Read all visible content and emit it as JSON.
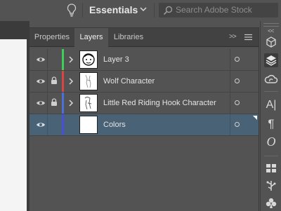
{
  "app_bar": {
    "workspace": "Essentials",
    "search_placeholder": "Search Adobe Stock"
  },
  "panel": {
    "tabs": [
      {
        "label": "Properties",
        "active": false
      },
      {
        "label": "Layers",
        "active": true
      },
      {
        "label": "Libraries",
        "active": false
      }
    ],
    "collapse_label": ">>",
    "layers": [
      {
        "name": "Layer 3",
        "color": "#3ecf5b",
        "locked": false,
        "visible": true,
        "expandable": true,
        "selected": false
      },
      {
        "name": "Wolf Character",
        "color": "#d94545",
        "locked": true,
        "visible": true,
        "expandable": true,
        "selected": false
      },
      {
        "name": "Little Red Riding Hook Character",
        "color": "#4a72d6",
        "locked": true,
        "visible": true,
        "expandable": true,
        "selected": false
      },
      {
        "name": "Colors",
        "color": "#4a4ed8",
        "locked": false,
        "visible": true,
        "expandable": false,
        "selected": true
      }
    ]
  },
  "tool_strip": {
    "icons": [
      "cube-icon",
      "layers-icon",
      "creative-cloud-icon",
      "character-icon",
      "paragraph-icon",
      "opentype-icon",
      "swatches-icon",
      "symbols-icon",
      "club-icon"
    ],
    "glyphs": {
      "character": "A|",
      "paragraph": "¶",
      "opentype": "O"
    },
    "selected": "layers-icon"
  }
}
